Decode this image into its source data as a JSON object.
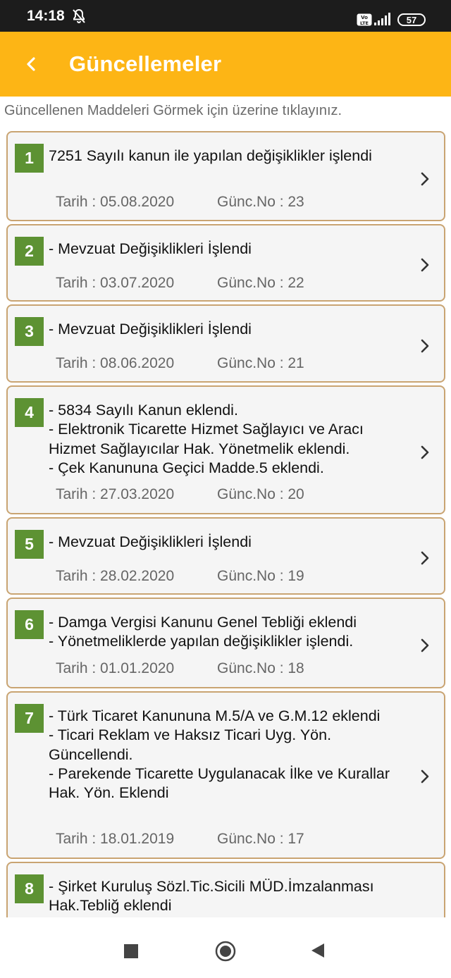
{
  "status_bar": {
    "time": "14:18",
    "volte": "Vo LTE",
    "battery": "57"
  },
  "app_bar": {
    "title": "Güncellemeler"
  },
  "hint": "Güncellenen Maddeleri Görmek için üzerine tıklayınız.",
  "updates": [
    {
      "num": "1",
      "text": "7251 Sayılı kanun ile yapılan değişiklikler işlendi",
      "tarih": "Tarih : 05.08.2020",
      "gunc": "Günc.No : 23"
    },
    {
      "num": "2",
      "text": "- Mevzuat Değişiklikleri İşlendi",
      "tarih": "Tarih : 03.07.2020",
      "gunc": "Günc.No : 22"
    },
    {
      "num": "3",
      "text": "- Mevzuat Değişiklikleri İşlendi",
      "tarih": "Tarih : 08.06.2020",
      "gunc": "Günc.No : 21"
    },
    {
      "num": "4",
      "text": "- 5834 Sayılı Kanun eklendi.\n- Elektronik Ticarette Hizmet Sağlayıcı ve Aracı Hizmet Sağlayıcılar Hak. Yönetmelik eklendi.\n- Çek Kanununa Geçici Madde.5 eklendi.",
      "tarih": "Tarih : 27.03.2020",
      "gunc": "Günc.No : 20"
    },
    {
      "num": "5",
      "text": "- Mevzuat Değişiklikleri İşlendi",
      "tarih": "Tarih : 28.02.2020",
      "gunc": "Günc.No : 19"
    },
    {
      "num": "6",
      "text": "- Damga Vergisi Kanunu Genel Tebliği eklendi\n- Yönetmeliklerde yapılan değişiklikler işlendi.",
      "tarih": "Tarih : 01.01.2020",
      "gunc": "Günc.No : 18"
    },
    {
      "num": "7",
      "text": "- Türk Ticaret Kanununa M.5/A ve G.M.12 eklendi\n- Ticari Reklam ve Haksız Ticari Uyg. Yön. Güncellendi.\n- Parekende Ticarette Uygulanacak İlke ve Kurallar Hak. Yön. Eklendi",
      "tarih": "Tarih : 18.01.2019",
      "gunc": "Günc.No : 17"
    },
    {
      "num": "8",
      "text": "- Şirket Kuruluş Sözl.Tic.Sicili MÜD.İmzalanması Hak.Tebliğ eklendi",
      "tarih": "",
      "gunc": ""
    }
  ]
}
